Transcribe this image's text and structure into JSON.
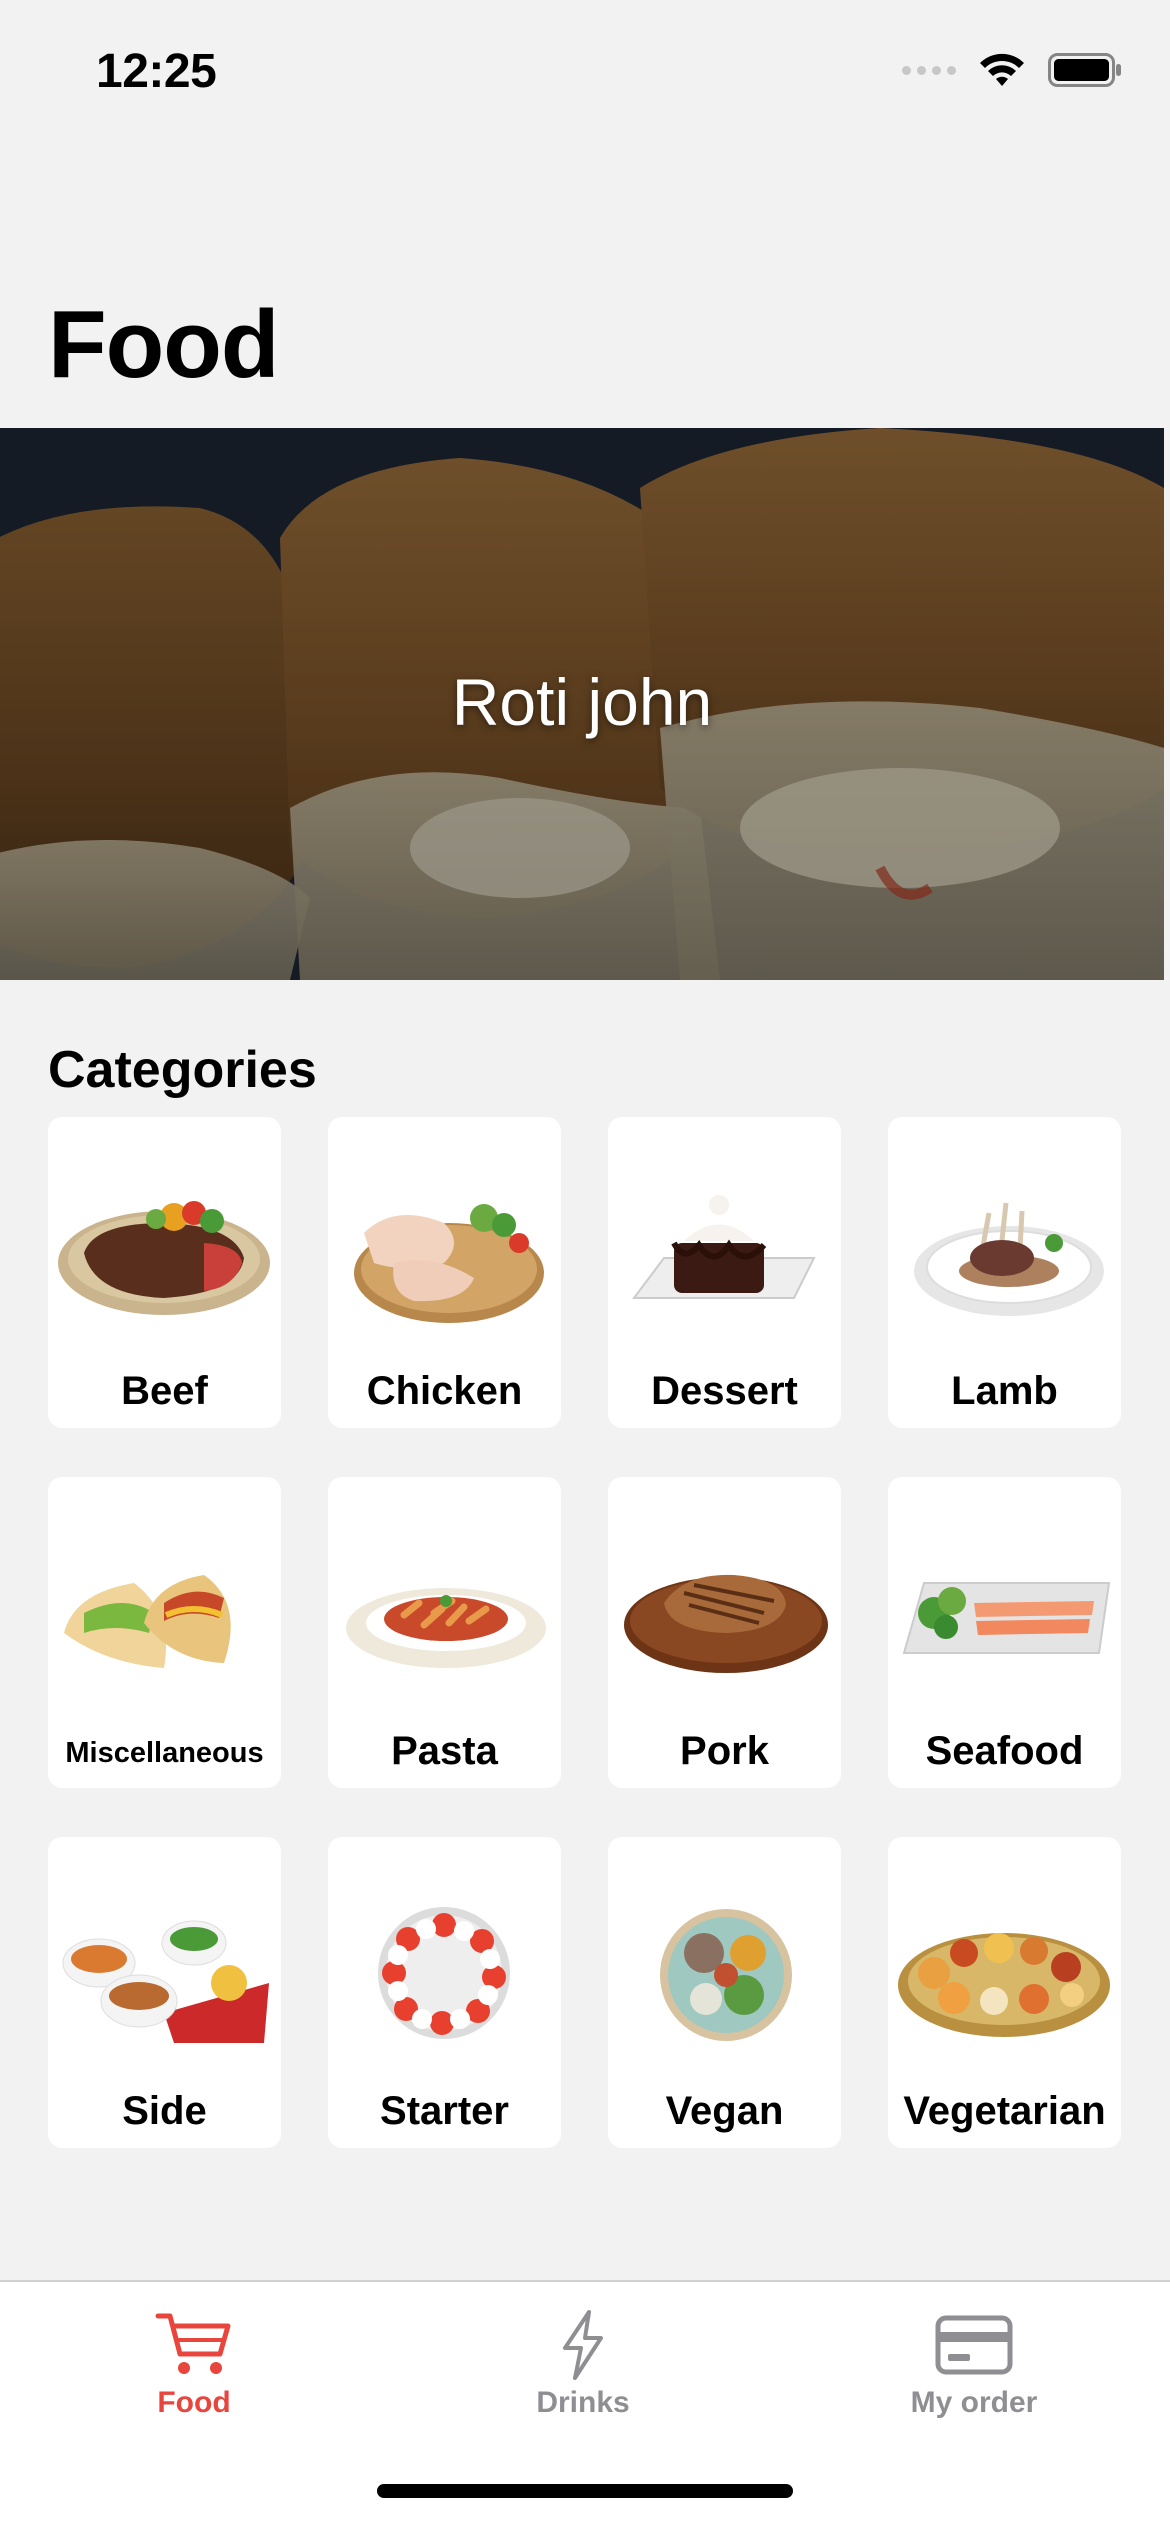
{
  "status_bar": {
    "time": "12:25"
  },
  "page": {
    "title": "Food"
  },
  "hero": {
    "label": "Roti john"
  },
  "categories": {
    "title": "Categories",
    "items": [
      {
        "label": "Beef"
      },
      {
        "label": "Chicken"
      },
      {
        "label": "Dessert"
      },
      {
        "label": "Lamb"
      },
      {
        "label": "Miscellaneous"
      },
      {
        "label": "Pasta"
      },
      {
        "label": "Pork"
      },
      {
        "label": "Seafood"
      },
      {
        "label": "Side"
      },
      {
        "label": "Starter"
      },
      {
        "label": "Vegan"
      },
      {
        "label": "Vegetarian"
      }
    ]
  },
  "tab_bar": {
    "tabs": [
      {
        "label": "Food",
        "icon": "cart-icon",
        "active": true
      },
      {
        "label": "Drinks",
        "icon": "lightning-icon",
        "active": false
      },
      {
        "label": "My order",
        "icon": "credit-card-icon",
        "active": false
      }
    ],
    "accent_color": "#e8453c",
    "inactive_color": "#8e8e93"
  }
}
